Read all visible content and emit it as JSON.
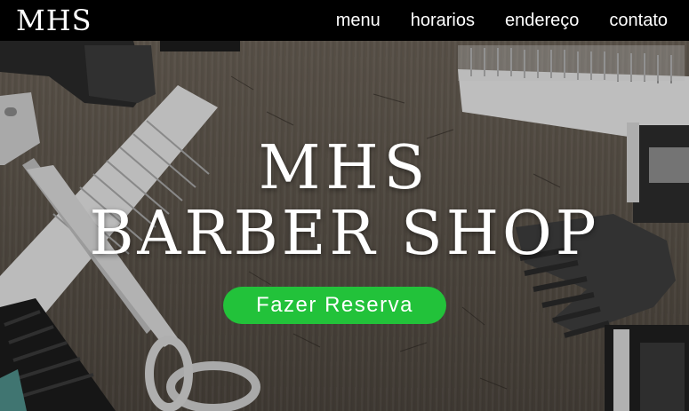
{
  "navbar": {
    "logo": "MHS",
    "links": [
      {
        "label": "menu"
      },
      {
        "label": "horarios"
      },
      {
        "label": "endereço"
      },
      {
        "label": "contato"
      }
    ]
  },
  "hero": {
    "title_line1": "MHS",
    "title_line2": "BARBER SHOP",
    "cta_label": "Fazer Reserva"
  },
  "colors": {
    "navbar_bg": "#000000",
    "cta_bg": "#22c23a",
    "text": "#ffffff"
  }
}
